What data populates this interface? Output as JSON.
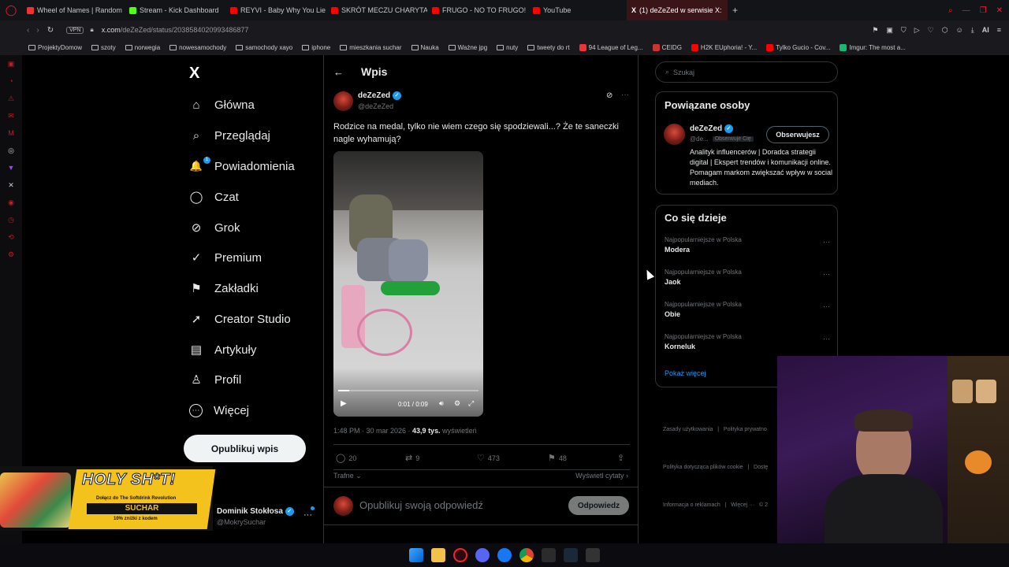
{
  "tabs": [
    {
      "label": "Wheel of Names | Random",
      "color": "#e33"
    },
    {
      "label": "Stream - Kick Dashboard",
      "color": "#53fc18"
    },
    {
      "label": "REYVI - Baby Why You Lie",
      "color": "#f00"
    },
    {
      "label": "SKRÓT MECZU CHARYTA",
      "color": "#f00"
    },
    {
      "label": "FRUGO - NO TO FRUGO!",
      "color": "#f00"
    },
    {
      "label": "YouTube",
      "color": "#f00"
    },
    {
      "label": "(1) deZeZed w serwisie X:",
      "color": "#ffffff"
    }
  ],
  "address": {
    "vpn": "VPN",
    "url_host": "x.com",
    "url_path": "/deZeZed/status/2038584020993486877",
    "ai": "AI"
  },
  "bookmarks": [
    "ProjektyDomow",
    "szoty",
    "norwegia",
    "nowesamochody",
    "samochody xayo",
    "iphone",
    "mieszkania suchar",
    "Nauka",
    "Ważne jpg",
    "nuty",
    "tweety do rt",
    "94 League of Leg...",
    "CEIDG",
    "H2K EUphoria! - Y...",
    "Tylko Gucio - Cov...",
    "Imgur: The most a..."
  ],
  "nav": {
    "logo": "X",
    "items": [
      {
        "label": "Główna",
        "icon": "home-icon",
        "glyph": "⌂"
      },
      {
        "label": "Przeglądaj",
        "icon": "search-icon",
        "glyph": "⌕"
      },
      {
        "label": "Powiadomienia",
        "icon": "bell-icon",
        "glyph": "🔔"
      },
      {
        "label": "Czat",
        "icon": "chat-icon",
        "glyph": "◯"
      },
      {
        "label": "Grok",
        "icon": "grok-icon",
        "glyph": "⊘"
      },
      {
        "label": "Premium",
        "icon": "premium-icon",
        "glyph": "✓"
      },
      {
        "label": "Zakładki",
        "icon": "bookmark-icon",
        "glyph": "⚑"
      },
      {
        "label": "Creator Studio",
        "icon": "rocket-icon",
        "glyph": "➚"
      },
      {
        "label": "Artykuły",
        "icon": "article-icon",
        "glyph": "▤"
      },
      {
        "label": "Profil",
        "icon": "profile-icon",
        "glyph": "♙"
      },
      {
        "label": "Więcej",
        "icon": "more-icon",
        "glyph": "⋯"
      }
    ],
    "notif_count": "1",
    "post_button": "Opublikuj wpis"
  },
  "account": {
    "name": "Dominik Stokłosa",
    "handle": "@MokrySuchar"
  },
  "post": {
    "header": "Wpis",
    "author": "deZeZed",
    "handle": "@deZeZed",
    "text": "Rodzice na medal, tylko nie wiem czego się spodziewali...? Że te saneczki nagle wyhamują?",
    "video_time": "0:01 / 0:09",
    "timestamp": "1:48 PM · 30 mar 2026 · ",
    "views": "43,9 tys.",
    "views_label": " wyświetleń",
    "stats": {
      "replies": "20",
      "reposts": "9",
      "likes": "473",
      "bookmarks": "48"
    },
    "sort": "Trafne",
    "quotes": "Wyświetl cytaty",
    "reply_placeholder": "Opublikuj swoją odpowiedź",
    "reply_button": "Odpowiedz"
  },
  "right": {
    "search_placeholder": "Szukaj",
    "related_title": "Powiązane osoby",
    "related_name": "deZeZed",
    "related_handle": "@de...",
    "follows_you": "Obserwuje Cię",
    "follow_button": "Obserwujesz",
    "bio": "Analityk influencerów | Doradca strategii digital | Ekspert trendów i komunikacji online. Pomagam markom zwiększać wpływ w social mediach.",
    "trends_title": "Co się dzieje",
    "trends": [
      {
        "cat": "Najpopularniejsze w Polska",
        "name": "Modera"
      },
      {
        "cat": "Najpopularniejsze w Polska",
        "name": "Jaok"
      },
      {
        "cat": "Najpopularniejsze w Polska",
        "name": "Obie"
      },
      {
        "cat": "Najpopularniejsze w Polska",
        "name": "Korneluk"
      }
    ],
    "show_more": "Pokaż więcej",
    "footer1": "Zasady użytkowania   |   Polityka prywatno",
    "footer2": "Polityka dotycząca plików cookie   |   Dostę",
    "footer3": "Informacja o reklamach   |   Więcej ···   © 2"
  },
  "overlay": {
    "banner_title": "HOLY SH*T!",
    "banner_sub": "Dołącz do The Softdrink Revolution",
    "banner_brand": "SUCHAR",
    "banner_promo": "10% zniżki z kodem"
  }
}
